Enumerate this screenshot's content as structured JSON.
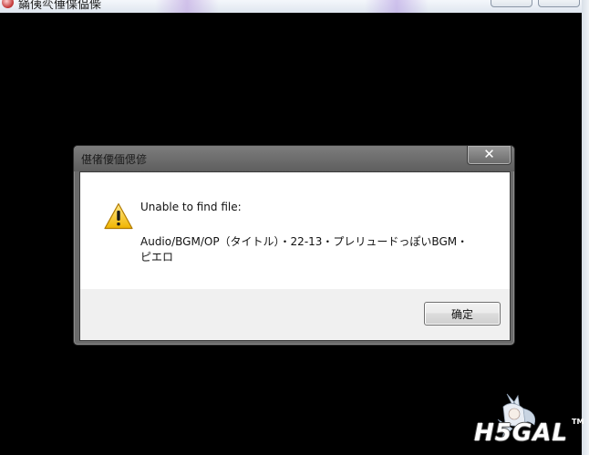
{
  "parent_window": {
    "title": "鏋侇亪倕偞偘偨"
  },
  "dialog": {
    "title": "偡偖偠偭偲偐",
    "close_label": "✕",
    "message_line1": "Unable to find file:",
    "message_line2": "Audio/BGM/OP（タイトル）・22-13・プレリュードっぽいBGM・",
    "message_line3": "ピエロ",
    "ok_label": "确定"
  },
  "watermark": {
    "text": "H5GAL",
    "tm": "TM"
  },
  "icons": {
    "warning": "warning-icon",
    "app": "app-icon",
    "close": "close-icon"
  }
}
